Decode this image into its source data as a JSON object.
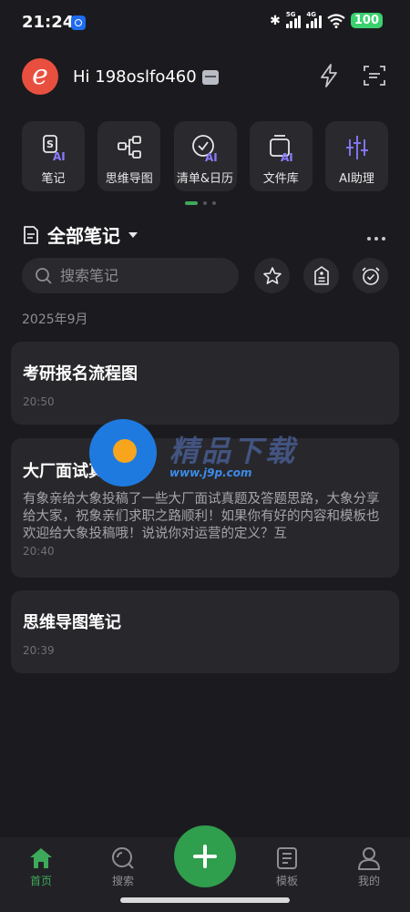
{
  "status_bar": {
    "time": "21:24",
    "network_5g": "5G",
    "network_4g": "4G",
    "battery": "100"
  },
  "header": {
    "avatar_letter": "e",
    "greeting": "Hi 198oslfo460",
    "avatar_color": "#e94f3f"
  },
  "shortcuts": [
    {
      "label": "笔记",
      "icon": "note-ai-icon"
    },
    {
      "label": "思维导图",
      "icon": "mindmap-icon"
    },
    {
      "label": "清单&日历",
      "icon": "checklist-ai-icon"
    },
    {
      "label": "文件库",
      "icon": "file-library-icon"
    },
    {
      "label": "AI助理",
      "icon": "ai-assistant-icon"
    }
  ],
  "notes": {
    "section_title": "全部笔记",
    "search_placeholder": "搜索笔记",
    "date_group": "2025年9月",
    "items": [
      {
        "title": "考研报名流程图",
        "preview": "",
        "time": "20:50"
      },
      {
        "title": "大厂面试真题",
        "preview": "有象亲给大象投稿了一些大厂面试真题及答题思路，大象分享给大家，祝象亲们求职之路顺利！如果你有好的内容和模板也欢迎给大象投稿哦！说说你对运营的定义？互",
        "time": "20:40"
      },
      {
        "title": "思维导图笔记",
        "preview": "",
        "time": "20:39"
      }
    ]
  },
  "watermark": {
    "text": "精品下载",
    "url": "www.j9p.com"
  },
  "bottom_nav": {
    "items": [
      {
        "label": "首页",
        "icon": "home-icon",
        "active": true
      },
      {
        "label": "搜索",
        "icon": "search-icon",
        "active": false
      },
      {
        "label": "模板",
        "icon": "template-icon",
        "active": false
      },
      {
        "label": "我的",
        "icon": "profile-icon",
        "active": false
      }
    ]
  },
  "colors": {
    "background": "#1b1b1f",
    "card": "#28282c",
    "accent_green": "#2f9e4d",
    "ai_purple": "#8a7cff"
  }
}
